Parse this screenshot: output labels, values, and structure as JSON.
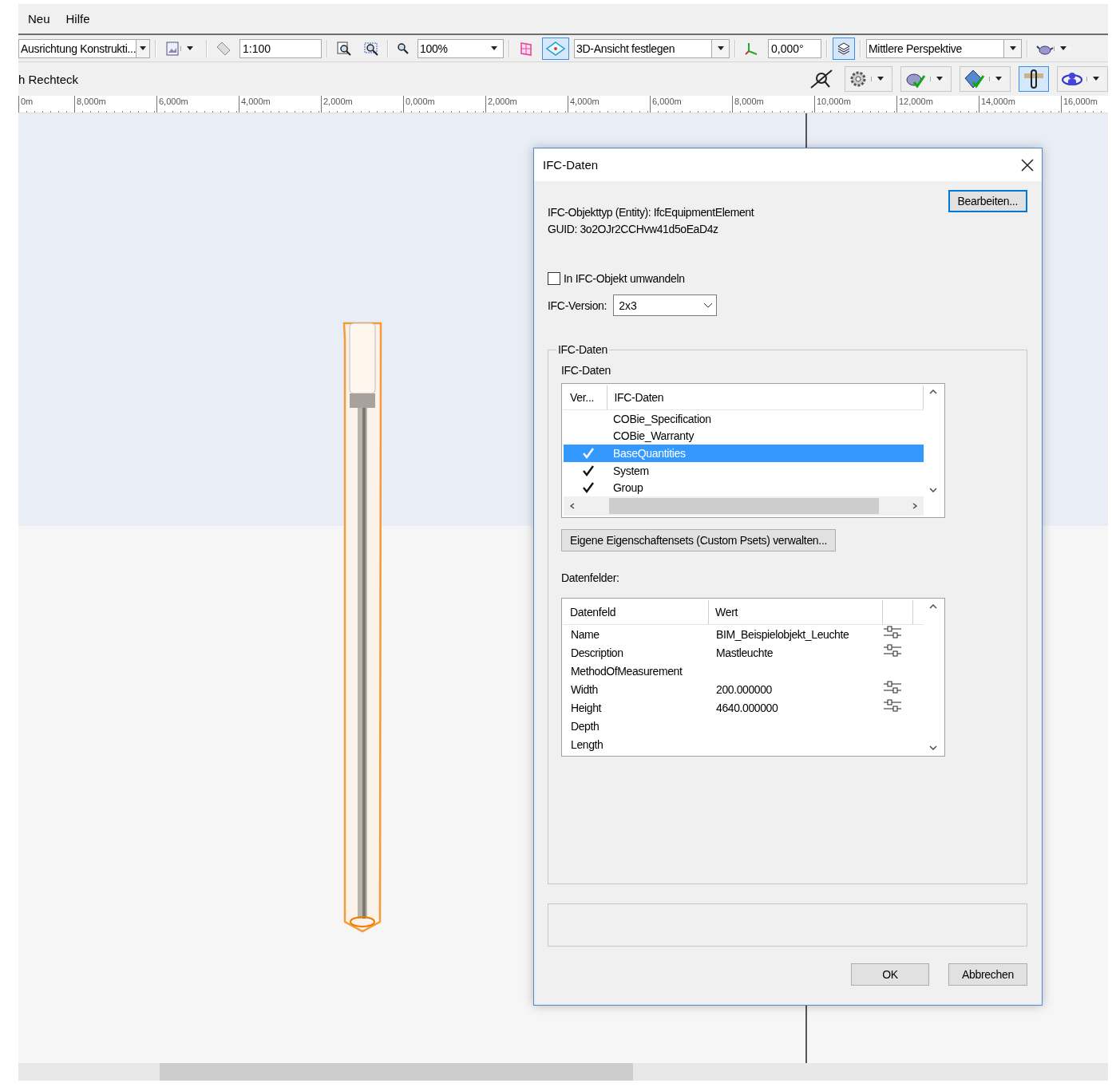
{
  "menu": [
    {
      "label": "Neu"
    },
    {
      "label": "Hilfe"
    }
  ],
  "toolbar": [
    {
      "kind": "combo",
      "value": "Ausrichtung Konstrukti..."
    },
    {
      "kind": "separator"
    },
    {
      "kind": "tool",
      "pressed": false,
      "menu": true
    },
    {
      "kind": "separator"
    },
    {
      "kind": "tool",
      "pressed": false,
      "menu": false
    },
    {
      "kind": "field",
      "value": "1:100"
    },
    {
      "kind": "separator"
    },
    {
      "kind": "tool",
      "pressed": false,
      "menu": false
    },
    {
      "kind": "tool",
      "pressed": false,
      "menu": false
    },
    {
      "kind": "separator"
    },
    {
      "kind": "tool",
      "pressed": false,
      "menu": false
    },
    {
      "kind": "combo",
      "value": "100%"
    },
    {
      "kind": "separator"
    },
    {
      "kind": "tool",
      "pressed": false,
      "menu": false
    },
    {
      "kind": "tool",
      "pressed": true,
      "menu": false
    },
    {
      "kind": "combo",
      "value": "3D-Ansicht festlegen"
    },
    {
      "kind": "separator"
    },
    {
      "kind": "tool",
      "pressed": false,
      "menu": false
    },
    {
      "kind": "field",
      "value": "0,000°"
    },
    {
      "kind": "separator"
    },
    {
      "kind": "tool",
      "pressed": true,
      "menu": false
    },
    {
      "kind": "separator"
    },
    {
      "kind": "combo",
      "value": "Mittlere Perspektive"
    },
    {
      "kind": "separator"
    },
    {
      "kind": "tool",
      "pressed": false,
      "menu": true
    }
  ],
  "toolbar_2": {
    "label": "h Rechteck",
    "tools": [
      {
        "pressed": false,
        "menu": false
      },
      {
        "pressed": false,
        "menu": true
      },
      {
        "pressed": false,
        "menu": true
      },
      {
        "pressed": false,
        "menu": true
      },
      {
        "pressed": true,
        "menu": false
      },
      {
        "pressed": false,
        "menu": true
      }
    ]
  },
  "ruler": [
    "0m",
    "8,000m",
    "6,000m",
    "4,000m",
    "2,000m",
    "0,000m",
    "2,000m",
    "4,000m",
    "6,000m",
    "8,000m",
    "10,000m",
    "12,000m",
    "14,000m",
    "16,000m"
  ],
  "dialog": {
    "title": "IFC-Daten",
    "entity_label": "IFC-Objekttyp (Entity):",
    "entity": "IfcEquipmentElement",
    "guid_label": "GUID:",
    "guid": "3o2OJr2CCHvw41d5oEaD4z",
    "edit_button": "Bearbeiten...",
    "convert": {
      "label": "In IFC-Objekt umwandeln",
      "checked": false
    },
    "version_label": "IFC-Version:",
    "version": "2x3",
    "group_title": "IFC-Daten",
    "list_label": "IFC-Daten",
    "list_columns": [
      "Ver...",
      "IFC-Daten"
    ],
    "list_rows": [
      {
        "name": "COBie_Specification",
        "checked": false,
        "selected": false
      },
      {
        "name": "COBie_Warranty",
        "checked": false,
        "selected": false
      },
      {
        "name": "BaseQuantities",
        "checked": true,
        "selected": true
      },
      {
        "name": "System",
        "checked": true,
        "selected": false
      },
      {
        "name": "Group",
        "checked": true,
        "selected": false
      }
    ],
    "psets_button": "Eigene Eigenschaftensets (Custom Psets) verwalten...",
    "fields_label": "Datenfelder:",
    "field_columns": [
      "Datenfeld",
      "Wert"
    ],
    "field_rows": [
      {
        "field": "Name",
        "value": "BIM_Beispielobjekt_Leuchte",
        "editable": true
      },
      {
        "field": "Description",
        "value": "Mastleuchte",
        "editable": true
      },
      {
        "field": "MethodOfMeasurement",
        "editable": false
      },
      {
        "field": "Width",
        "value": "200.000000",
        "editable": true
      },
      {
        "field": "Height",
        "value": "4640.000000",
        "editable": true
      },
      {
        "field": "Depth",
        "editable": false
      },
      {
        "field": "Length",
        "editable": false
      }
    ],
    "buttons": [
      "OK",
      "Abbrechen"
    ]
  }
}
